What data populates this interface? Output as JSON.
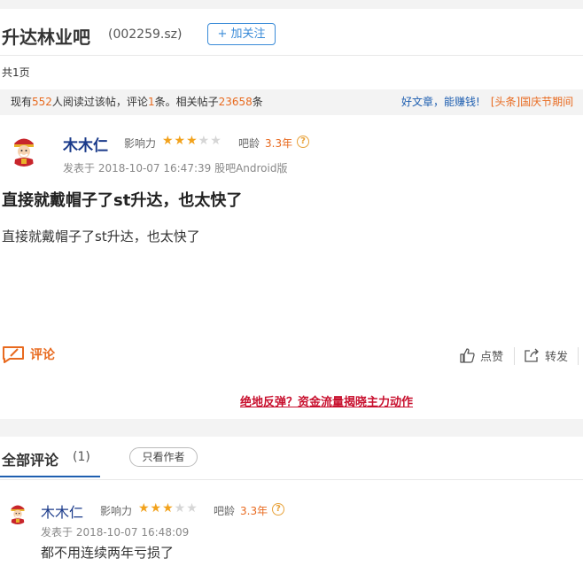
{
  "header": {
    "bar_name": "升达林业吧",
    "stock_code": "(002259.sz)",
    "follow_label": "+ 加关注"
  },
  "pagination": {
    "text": "共1页"
  },
  "stats": {
    "prefix": "现有",
    "readers": "552",
    "mid1": "人阅读过该帖，评论",
    "comments": "1",
    "mid2": "条。相关帖子",
    "related": "23658",
    "suffix": "条",
    "good_article": "好文章，能赚钱!",
    "headline": "[头条]国庆节期间"
  },
  "post": {
    "author": "木木仁",
    "influence_label": "影响力",
    "stars_total": 5,
    "stars_filled": 3,
    "age_label": "吧龄",
    "age_value": "3.3年",
    "meta": "发表于 2018-10-07 16:47:39 股吧Android版",
    "title": "直接就戴帽子了st升达，也太快了",
    "body": "直接就戴帽子了st升达，也太快了"
  },
  "actions": {
    "comment": "评论",
    "like": "点赞",
    "share": "转发"
  },
  "ad": {
    "text": "绝地反弹？资金流量揭晓主力动作"
  },
  "comments_section": {
    "title": "全部评论",
    "count": "(1)",
    "author_only": "只看作者"
  },
  "reply": {
    "author": "木木仁",
    "influence_label": "影响力",
    "stars_total": 5,
    "stars_filled": 3,
    "age_label": "吧龄",
    "age_value": "3.3年",
    "meta": "发表于 2018-10-07 16:48:09",
    "text": "都不用连续两年亏损了"
  },
  "colors": {
    "accent_orange": "#e86a1f",
    "link_blue": "#1f5fb0",
    "ad_red": "#c8102e",
    "star": "#f2a21c"
  }
}
